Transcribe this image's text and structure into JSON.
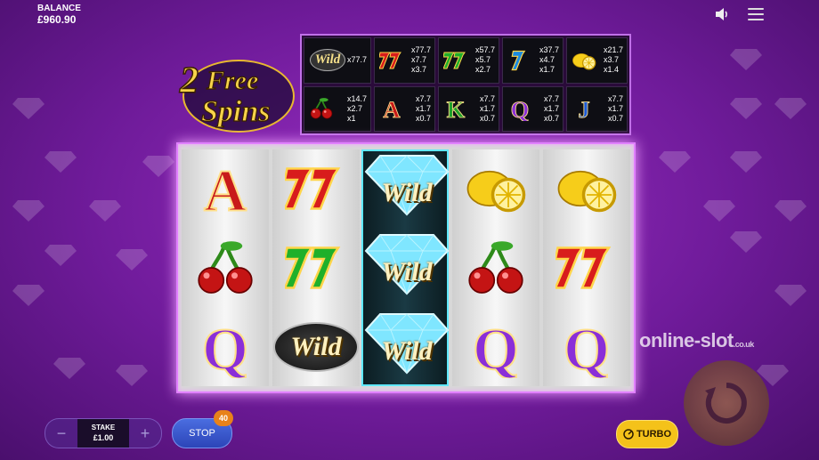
{
  "balance": {
    "label": "BALANCE",
    "value": "£960.90"
  },
  "free_spins": {
    "count": "2",
    "line1": "Free",
    "line2": "Spins"
  },
  "paytable": [
    {
      "symbol": "wild",
      "label": "Wild",
      "pays": [
        "x77.7"
      ]
    },
    {
      "symbol": "red-seven",
      "label": "77",
      "pays": [
        "x77.7",
        "x7.7",
        "x3.7"
      ]
    },
    {
      "symbol": "green-seven",
      "label": "77",
      "pays": [
        "x57.7",
        "x5.7",
        "x2.7"
      ]
    },
    {
      "symbol": "blue-seven",
      "label": "7",
      "pays": [
        "x37.7",
        "x4.7",
        "x1.7"
      ]
    },
    {
      "symbol": "lemon",
      "label": "",
      "pays": [
        "x21.7",
        "x3.7",
        "x1.4"
      ]
    },
    {
      "symbol": "cherry",
      "label": "",
      "pays": [
        "x14.7",
        "x2.7",
        "x1"
      ]
    },
    {
      "symbol": "ace",
      "label": "A",
      "pays": [
        "x7.7",
        "x1.7",
        "x0.7"
      ]
    },
    {
      "symbol": "king",
      "label": "K",
      "pays": [
        "x7.7",
        "x1.7",
        "x0.7"
      ]
    },
    {
      "symbol": "queen",
      "label": "Q",
      "pays": [
        "x7.7",
        "x1.7",
        "x0.7"
      ]
    },
    {
      "symbol": "jack",
      "label": "J",
      "pays": [
        "x7.7",
        "x1.7",
        "x0.7"
      ]
    }
  ],
  "reels": [
    [
      "ace",
      "cherry",
      "queen"
    ],
    [
      "red-seven",
      "green-seven",
      "wild"
    ],
    [
      "diamond-wild",
      "diamond-wild",
      "diamond-wild"
    ],
    [
      "lemon",
      "cherry",
      "queen"
    ],
    [
      "lemon",
      "red-seven",
      "queen"
    ]
  ],
  "symbol_text": {
    "ace": "A",
    "queen": "Q",
    "wild": "Wild",
    "diamond-wild": "Wild",
    "red-seven": "77",
    "green-seven": "77"
  },
  "watermark": {
    "text": "online-slot",
    "suffix": ".co.uk"
  },
  "controls": {
    "stake_label": "STAKE",
    "stake_value": "£1.00",
    "stop_label": "STOP",
    "autoplay_count": "40",
    "turbo_label": "TURBO"
  },
  "colors": {
    "background": "#7a1fa8",
    "frame_glow": "#e080ff",
    "wild_reel_border": "#5fe8ff",
    "stop_button": "#3a56cc",
    "turbo_button": "#f4c21a",
    "counter_badge": "#e8821a"
  }
}
